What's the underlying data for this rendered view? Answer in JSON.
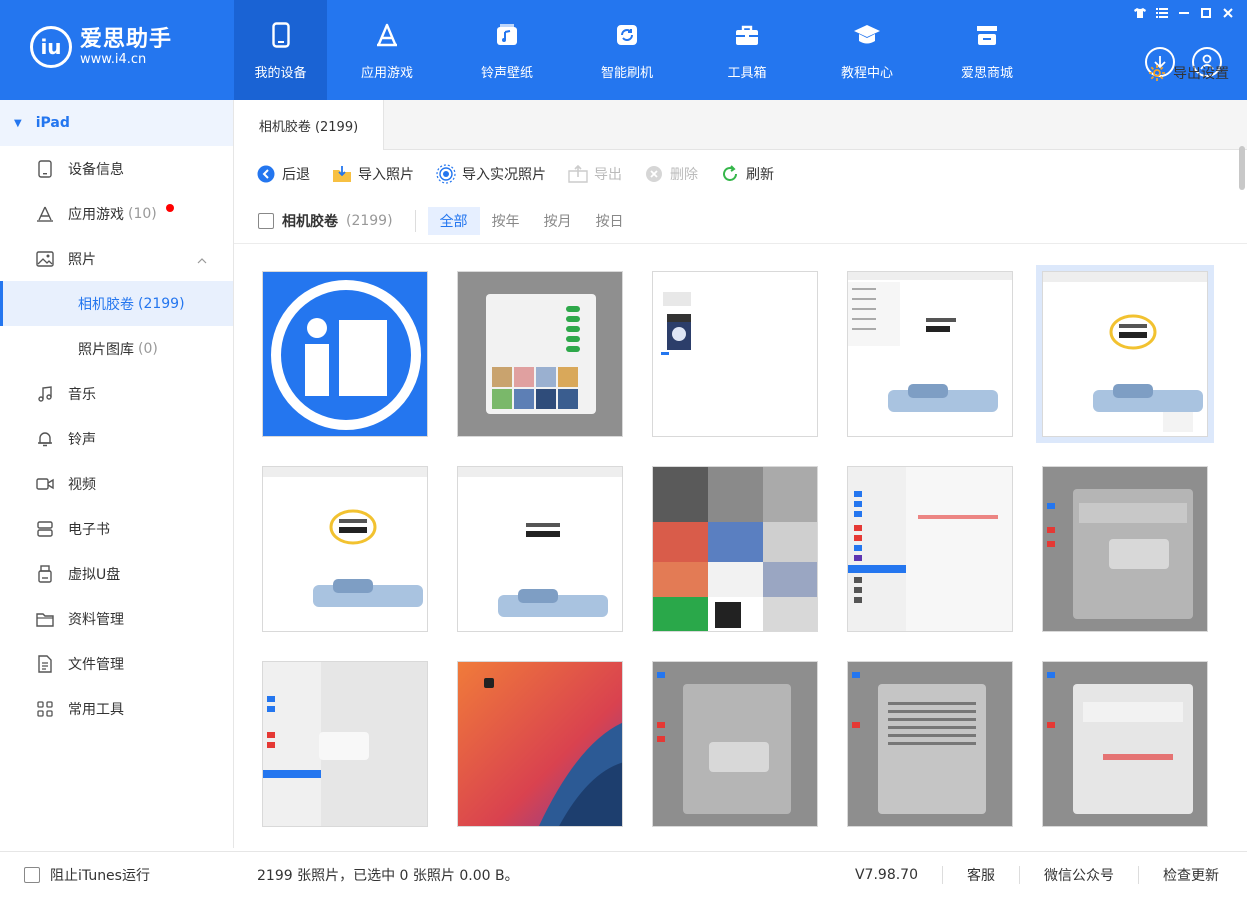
{
  "app": {
    "logo_text": "爱思助手",
    "logo_url": "www.i4.cn",
    "logo_mark": "iu"
  },
  "nav": [
    {
      "label": "我的设备",
      "icon": "phone-icon",
      "active": true
    },
    {
      "label": "应用游戏",
      "icon": "app-store-icon"
    },
    {
      "label": "铃声壁纸",
      "icon": "music-note-icon"
    },
    {
      "label": "智能刷机",
      "icon": "refresh-icon"
    },
    {
      "label": "工具箱",
      "icon": "toolbox-icon"
    },
    {
      "label": "教程中心",
      "icon": "graduation-cap-icon"
    },
    {
      "label": "爱思商城",
      "icon": "store-icon"
    }
  ],
  "sidebar": {
    "device": "iPad",
    "items": [
      {
        "label": "设备信息",
        "icon": "tablet-icon"
      },
      {
        "label": "应用游戏",
        "count": "(10)",
        "icon": "apps-icon",
        "badge": true
      },
      {
        "label": "照片",
        "icon": "image-icon",
        "expanded": true
      },
      {
        "label": "音乐",
        "icon": "music-icon"
      },
      {
        "label": "铃声",
        "icon": "bell-icon"
      },
      {
        "label": "视频",
        "icon": "video-icon"
      },
      {
        "label": "电子书",
        "icon": "book-icon"
      },
      {
        "label": "虚拟U盘",
        "icon": "usb-icon"
      },
      {
        "label": "资料管理",
        "icon": "folder-icon"
      },
      {
        "label": "文件管理",
        "icon": "file-icon"
      },
      {
        "label": "常用工具",
        "icon": "grid-icon"
      }
    ],
    "photo_sub": [
      {
        "label": "相机胶卷",
        "count": "(2199)",
        "active": true
      },
      {
        "label": "照片图库",
        "count": "(0)"
      }
    ]
  },
  "main": {
    "tab": "相机胶卷 (2199)",
    "toolbar": {
      "back": "后退",
      "import_photo": "导入照片",
      "import_live": "导入实况照片",
      "export": "导出",
      "delete": "删除",
      "refresh": "刷新",
      "export_settings": "导出设置"
    },
    "filter": {
      "title": "相机胶卷",
      "count": "(2199)",
      "tabs": [
        "全部",
        "按年",
        "按月",
        "按日"
      ]
    }
  },
  "footer": {
    "block_itunes": "阻止iTunes运行",
    "status": "2199 张照片，已选中 0 张照片 0.00 B。",
    "version": "V7.98.70",
    "service": "客服",
    "wechat": "微信公众号",
    "update": "检查更新"
  },
  "colors": {
    "brand": "#2476ef",
    "nav_active": "#1a63d4",
    "badge": "#ff0000"
  }
}
